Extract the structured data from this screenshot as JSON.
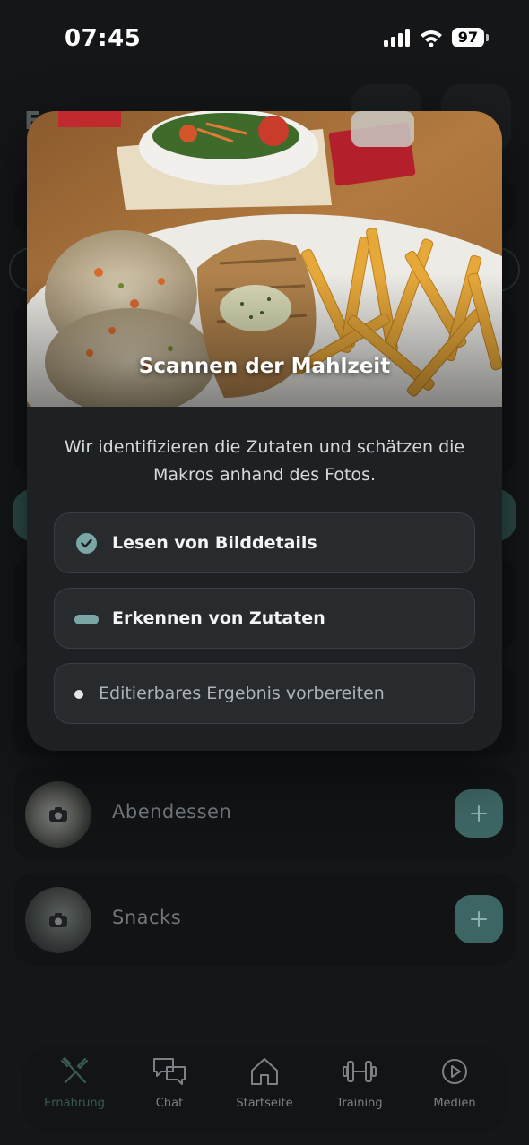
{
  "status_bar": {
    "time": "07:45",
    "battery": "97"
  },
  "background": {
    "header_title": "Er",
    "meals": [
      {
        "name": "Abendessen",
        "add_label": "+"
      },
      {
        "name": "Snacks",
        "add_label": "+"
      }
    ]
  },
  "modal": {
    "title": "Scannen der Mahlzeit",
    "description": "Wir identifizieren die Zutaten und schätzen die Makros anhand des Fotos.",
    "steps": [
      {
        "label": "Lesen von Bilddetails",
        "state": "done"
      },
      {
        "label": "Erkennen von Zutaten",
        "state": "active"
      },
      {
        "label": "Editierbares Ergebnis vorbereiten",
        "state": "pending"
      }
    ]
  },
  "nav": {
    "items": [
      {
        "label": "Ernährung",
        "icon": "fork-knife-icon",
        "active": true
      },
      {
        "label": "Chat",
        "icon": "chat-bubbles-icon",
        "active": false
      },
      {
        "label": "Startseite",
        "icon": "home-icon",
        "active": false
      },
      {
        "label": "Training",
        "icon": "dumbbell-icon",
        "active": false
      },
      {
        "label": "Medien",
        "icon": "play-circle-icon",
        "active": false
      }
    ]
  },
  "colors": {
    "accent": "#7aa6a6",
    "accent_dark": "#3d6563",
    "background": "#141618",
    "modal": "#1e2124"
  }
}
